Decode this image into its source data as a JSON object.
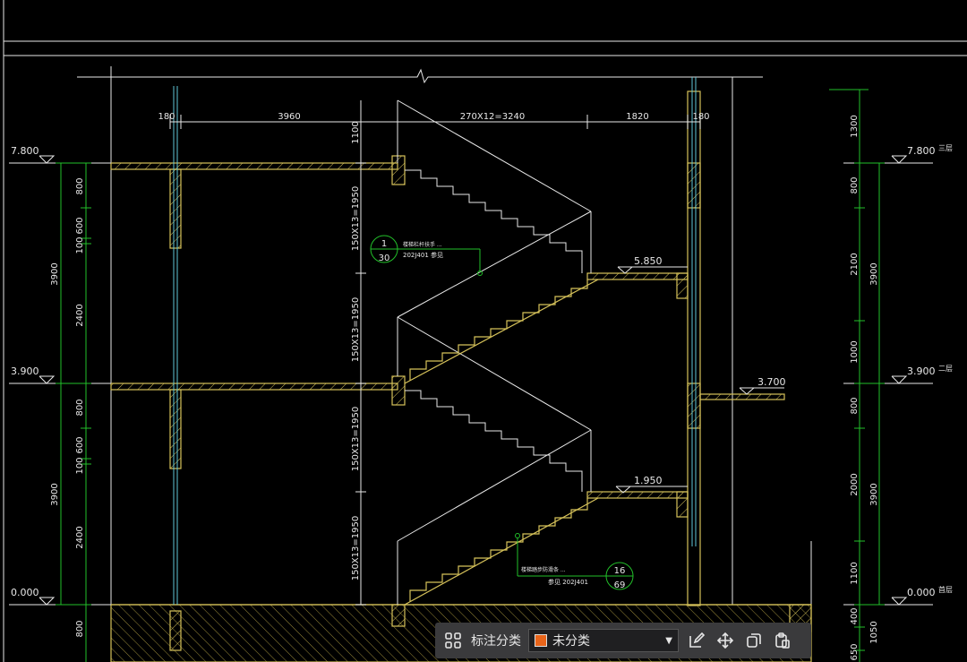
{
  "colors": {
    "background": "#000000",
    "wall": "#d6c25a",
    "dimension": "#22c02a",
    "line": "#e8e8e8",
    "glass": "#5fc6d8",
    "annotation": "#22c02a",
    "category_swatch": "#e8641a"
  },
  "drawing": {
    "top_dimensions": [
      "180",
      "3960",
      "270X12=3240",
      "1820",
      "180"
    ],
    "left_elevations": [
      "7.800",
      "3.900",
      "0.000"
    ],
    "right_elevations": [
      "7.800",
      "3.900",
      "0.000"
    ],
    "floor_names": [
      "三层",
      "二层",
      "首层"
    ],
    "landing_elevations": [
      "5.850",
      "1.950",
      "3.700"
    ],
    "left_dims_upper": [
      "800",
      "600",
      "100",
      "2400",
      "3900"
    ],
    "left_dims_lower": [
      "800",
      "600",
      "100",
      "2400",
      "3900"
    ],
    "left_dims_base": "800",
    "flight_dims": [
      "1100",
      "150X13=1950",
      "150X13=1950",
      "150X13=1950",
      "150X13=1950"
    ],
    "right_dims": [
      "1300",
      "800",
      "2100",
      "3900",
      "1000",
      "800",
      "2000",
      "3900",
      "1100",
      "400",
      "650",
      "1050"
    ],
    "callout_upper": {
      "top": "1",
      "bottom": "30",
      "line1": "楼梯栏杆扶手 ...",
      "line2": "202J401 参见"
    },
    "callout_lower": {
      "top": "16",
      "bottom": "69",
      "line1": "楼梯踏步防滑条 ...",
      "line2": "参见 202J401"
    }
  },
  "toolbar": {
    "group_icon": "grid-icon",
    "category_label": "标注分类",
    "category_value": "未分类",
    "edit_icon": "edit-icon",
    "move_icon": "move-icon",
    "copy_icon": "copy-icon",
    "paste_icon": "paste-icon"
  }
}
